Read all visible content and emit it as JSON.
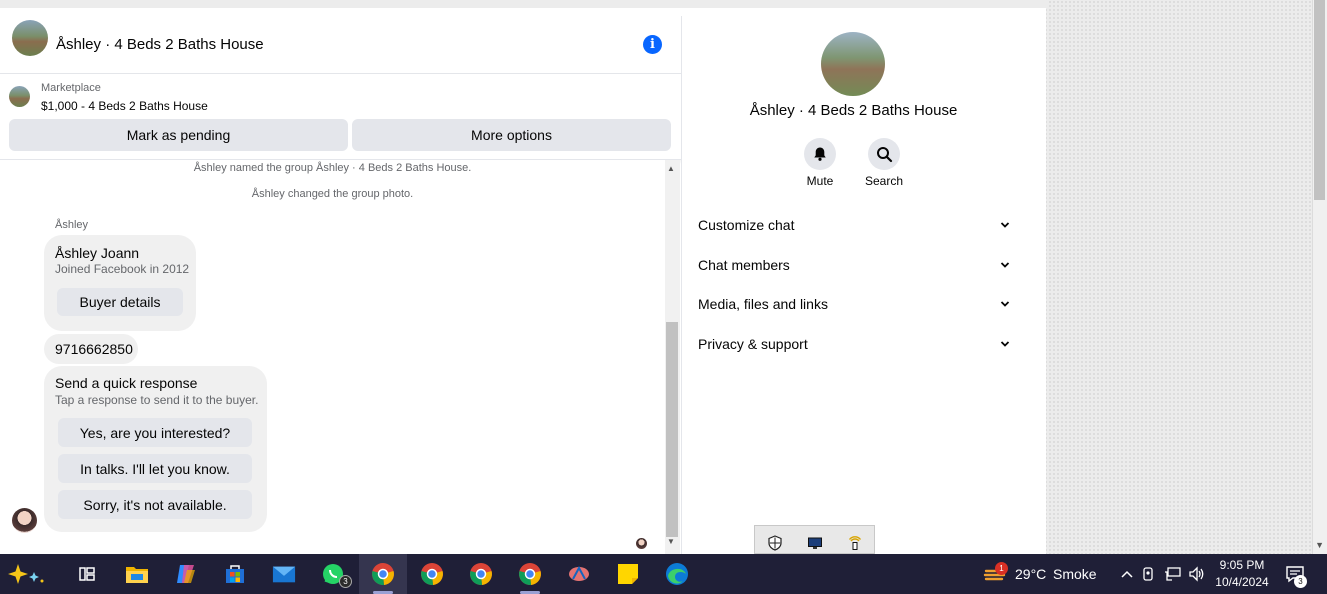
{
  "header": {
    "title": "Åshley · 4 Beds 2 Baths House"
  },
  "marketplace": {
    "label": "Marketplace",
    "listing": "$1,000 - 4 Beds 2 Baths House",
    "mark_pending": "Mark as pending",
    "more_options": "More options"
  },
  "messages": {
    "sys1": "Åshley named the group Åshley · 4 Beds 2 Baths House.",
    "sys2": "Åshley changed the group photo.",
    "sender": "Åshley",
    "card_name": "Åshley Joann",
    "card_sub": "Joined Facebook in 2012",
    "buyer_details": "Buyer details",
    "phone": "9716662850",
    "quick_title": "Send a quick response",
    "quick_sub": "Tap a response to send it to the buyer.",
    "quick_1": "Yes, are you interested?",
    "quick_2": "In talks. I'll let you know.",
    "quick_3": "Sorry, it's not available."
  },
  "panel": {
    "title": "Åshley · 4 Beds 2 Baths House",
    "mute": "Mute",
    "search": "Search",
    "rows": [
      "Customize chat",
      "Chat members",
      "Media, files and links",
      "Privacy & support"
    ]
  },
  "taskbar": {
    "whatsapp_badge": "3",
    "weather_badge": "1",
    "temperature": "29°C",
    "weather": "Smoke",
    "time": "9:05 PM",
    "date": "10/4/2024",
    "notif_badge": "3"
  },
  "colors": {
    "accent": "#0866ff",
    "taskbar": "#1f1f37"
  }
}
